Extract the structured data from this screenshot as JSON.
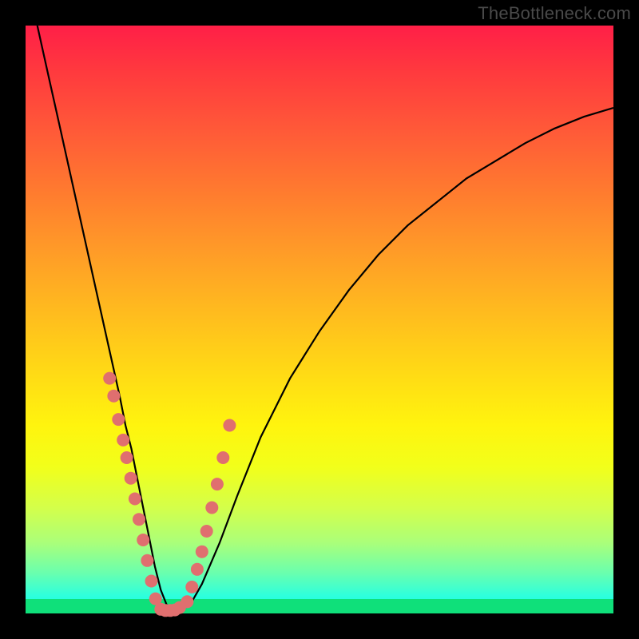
{
  "watermark": "TheBottleneck.com",
  "chart_data": {
    "type": "line",
    "title": "",
    "xlabel": "",
    "ylabel": "",
    "xlim": [
      0,
      100
    ],
    "ylim": [
      0,
      100
    ],
    "curve": {
      "name": "bottleneck-curve",
      "x": [
        2,
        4,
        6,
        8,
        10,
        12,
        14,
        16,
        17,
        18,
        19,
        20,
        21,
        22,
        23,
        24,
        25,
        26,
        28,
        30,
        33,
        36,
        40,
        45,
        50,
        55,
        60,
        65,
        70,
        75,
        80,
        85,
        90,
        95,
        100
      ],
      "y": [
        100,
        91,
        82,
        73,
        64,
        55,
        46,
        37,
        32,
        28,
        23,
        18,
        13,
        8,
        4,
        1.5,
        0.5,
        0.5,
        1.5,
        5,
        12,
        20,
        30,
        40,
        48,
        55,
        61,
        66,
        70,
        74,
        77,
        80,
        82.5,
        84.5,
        86
      ]
    },
    "dots_left": {
      "x": [
        14.3,
        15.0,
        15.8,
        16.6,
        17.2,
        17.9,
        18.6,
        19.3,
        20.0,
        20.7,
        21.4,
        22.1
      ],
      "y": [
        40,
        37,
        33,
        29.5,
        26.5,
        23,
        19.5,
        16,
        12.5,
        9,
        5.5,
        2.5
      ]
    },
    "dots_right": {
      "x": [
        27.5,
        28.3,
        29.2,
        30.0,
        30.8,
        31.7,
        32.6,
        33.6,
        34.7
      ],
      "y": [
        2,
        4.5,
        7.5,
        10.5,
        14,
        18,
        22,
        26.5,
        32
      ]
    },
    "dots_bottom": {
      "x": [
        23.0,
        23.8,
        24.6,
        25.4,
        26.2
      ],
      "y": [
        0.7,
        0.5,
        0.5,
        0.6,
        1.0
      ]
    },
    "gradient_stops": [
      {
        "pos": 0,
        "color": "#ff1f47"
      },
      {
        "pos": 0.5,
        "color": "#ffd716"
      },
      {
        "pos": 0.98,
        "color": "#2effdc"
      },
      {
        "pos": 1,
        "color": "#0fe07a"
      }
    ]
  }
}
